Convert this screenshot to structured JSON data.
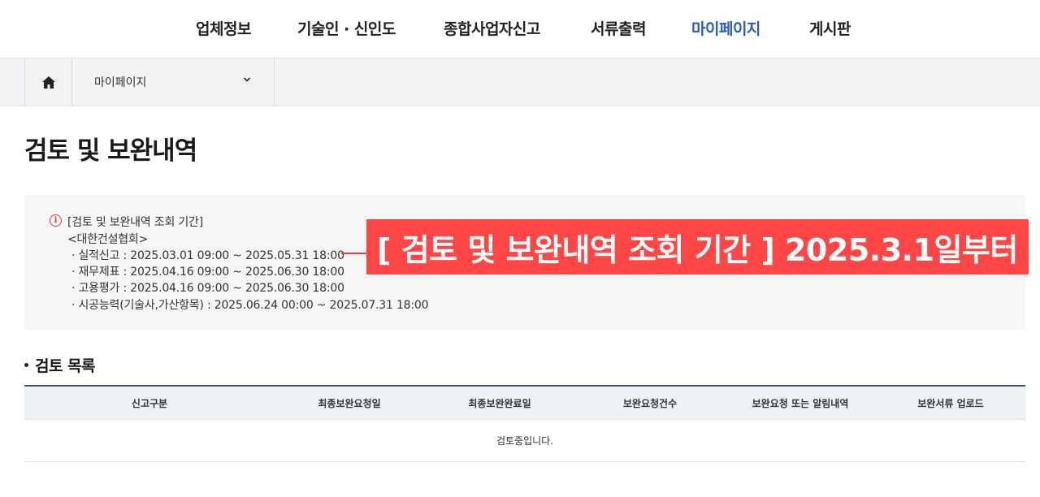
{
  "nav": {
    "items": [
      "업체정보",
      "기술인 · 신인도",
      "종합사업자신고",
      "서류출력",
      "마이페이지",
      "게시판"
    ],
    "active_index": 4
  },
  "breadcrumb": {
    "home_icon": "home-icon",
    "current": "마이페이지",
    "dropdown_icon": "chevron-down-icon"
  },
  "page": {
    "title": "검토 및 보완내역"
  },
  "info": {
    "heading": "[검토 및 보완내역 조회 기간]",
    "org": "<대한건설협회>",
    "lines": [
      "· 실적신고 : 2025.03.01 09:00 ~ 2025.05.31 18:00",
      "· 재무제표 : 2025.04.16 09:00 ~ 2025.06.30 18:00",
      "· 고용평가 : 2025.04.16 09:00 ~ 2025.06.30 18:00",
      "· 시공능력(기술사,가산항목) : 2025.06.24 00:00 ~ 2025.07.31 18:00"
    ]
  },
  "banner": {
    "text": "[ 검토 및 보완내역 조회 기간 ] 2025.3.1일부터"
  },
  "review_list": {
    "title": "검토 목록",
    "columns": [
      "신고구분",
      "최종보완요청일",
      "최종보완완료일",
      "보완요청건수",
      "보완요청 또는 알림내역",
      "보완서류 업로드"
    ],
    "empty_message": "검토중입니다."
  },
  "colors": {
    "active_nav": "#2b57c8",
    "banner_bg": "#ff4646",
    "table_header_border": "#3b5877"
  }
}
